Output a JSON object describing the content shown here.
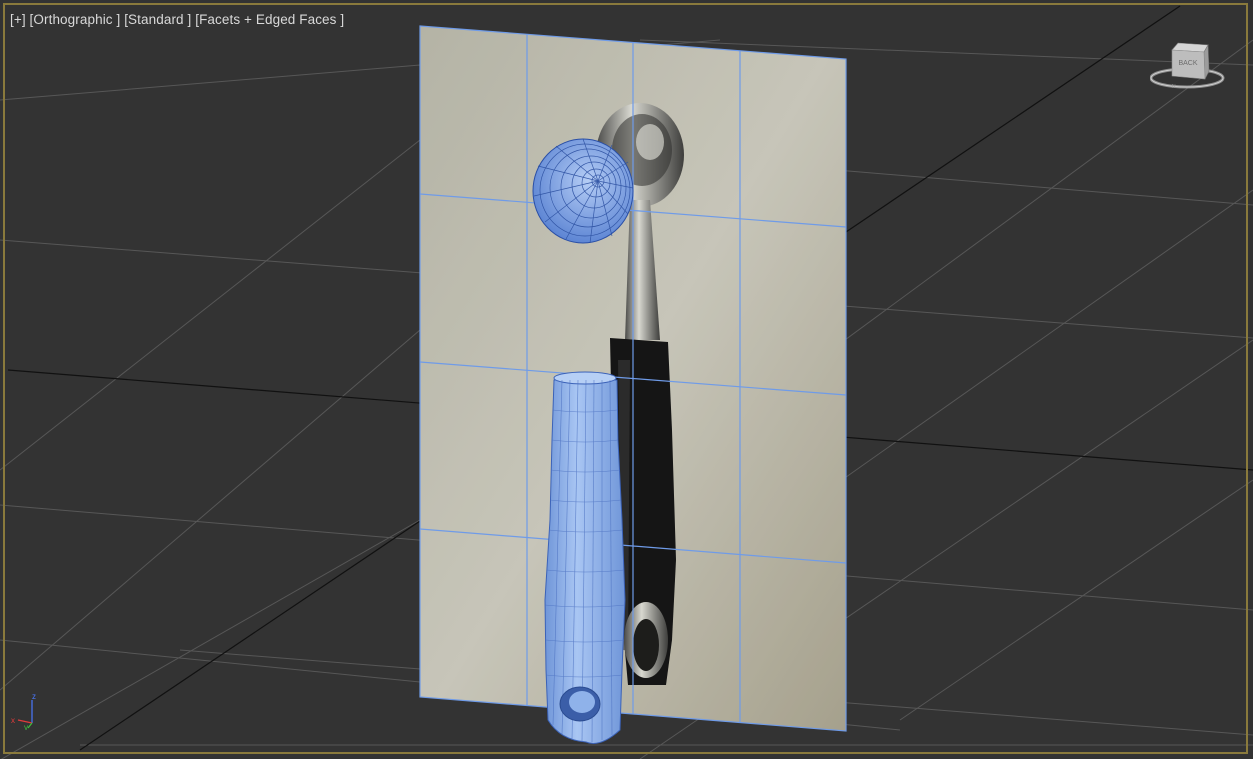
{
  "viewport": {
    "menu_plus": "[+]",
    "view_mode": "[Orthographic ]",
    "shading": "[Standard ]",
    "display_mode": "[Facets + Edged Faces ]"
  },
  "viewcube": {
    "face_label": "BACK",
    "icon": "viewcube-icon"
  },
  "axis_tripod": {
    "x_label": "x",
    "y_label": "y",
    "z_label": "z"
  },
  "colors": {
    "viewport_bg": "#333333",
    "grid": "#5a5a5a",
    "grid_major": "#111111",
    "border_active": "#8a7a3c",
    "wire_selected": "#5c8fe6",
    "mesh_fill": "#8eb3ec"
  }
}
